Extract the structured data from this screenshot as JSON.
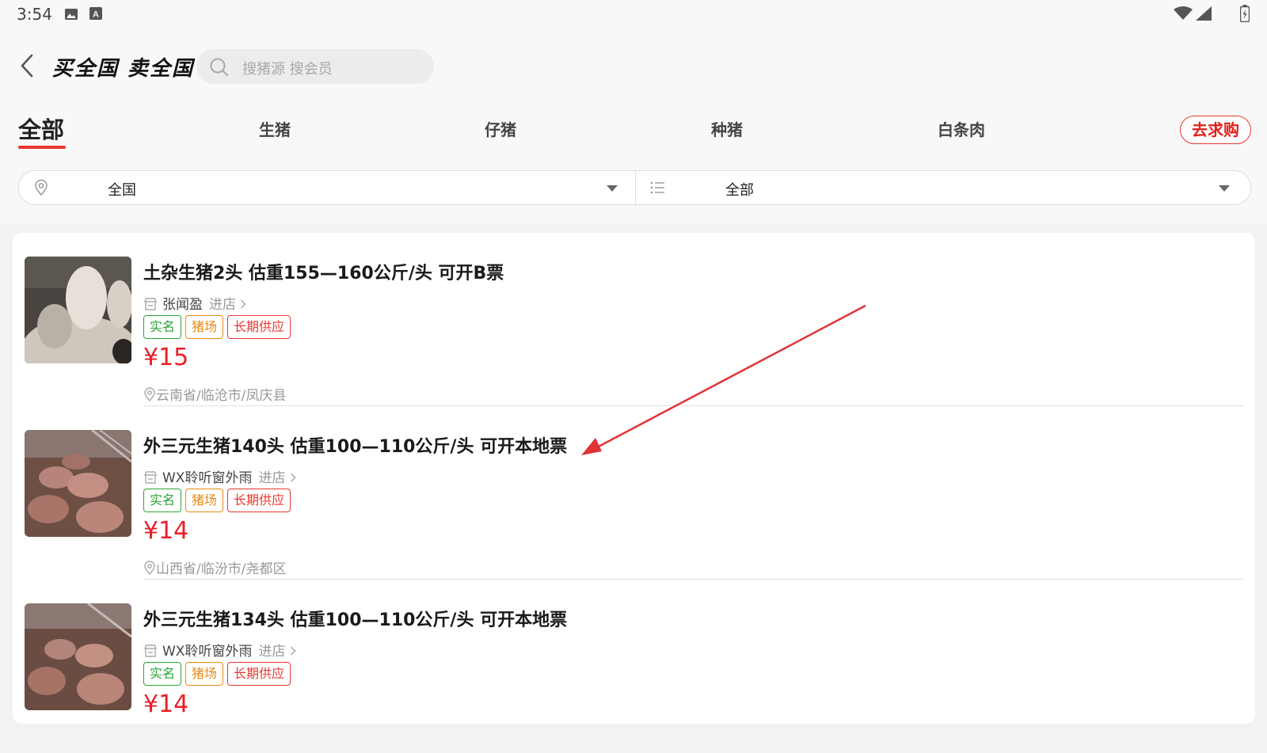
{
  "status_bar": {
    "time": "3:54",
    "icons": [
      "image-icon",
      "a-notification-icon",
      "wifi-icon",
      "signal-icon",
      "battery-icon"
    ]
  },
  "header": {
    "back_icon": "chevron-left-icon",
    "logo": "买全国 卖全国",
    "search_placeholder": "搜猪源 搜会员"
  },
  "tabs": [
    {
      "label": "全部",
      "active": true
    },
    {
      "label": "生猪",
      "active": false
    },
    {
      "label": "仔猪",
      "active": false
    },
    {
      "label": "种猪",
      "active": false
    },
    {
      "label": "白条肉",
      "active": false
    }
  ],
  "request_button": "去求购",
  "filters": {
    "region": "全国",
    "category": "全部"
  },
  "listings": [
    {
      "title": "土杂生猪2头 估重155—160公斤/头 可开B票",
      "seller": "张闻盈",
      "shop_link": "进店",
      "tags": [
        "实名",
        "猪场",
        "长期供应"
      ],
      "price": "¥15",
      "location": "云南省/临沧市/凤庆县"
    },
    {
      "title": "外三元生猪140头 估重100—110公斤/头 可开本地票",
      "seller": "WX聆听窗外雨",
      "shop_link": "进店",
      "tags": [
        "实名",
        "猪场",
        "长期供应"
      ],
      "price": "¥14",
      "location": "山西省/临汾市/尧都区"
    },
    {
      "title": "外三元生猪134头 估重100—110公斤/头 可开本地票",
      "seller": "WX聆听窗外雨",
      "shop_link": "进店",
      "tags": [
        "实名",
        "猪场",
        "长期供应"
      ],
      "price": "¥14",
      "location": ""
    }
  ],
  "colors": {
    "accent": "#e8372f",
    "price": "#e8202a",
    "tag_green": "#2aa536",
    "tag_orange": "#e98a12"
  }
}
